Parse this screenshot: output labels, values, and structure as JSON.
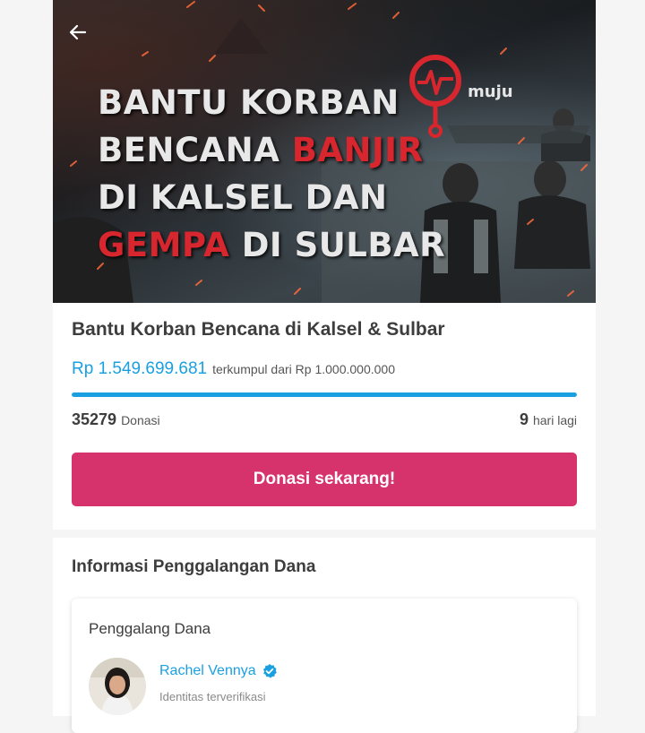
{
  "hero": {
    "title_lines": [
      {
        "parts": [
          "BANTU KORBAN",
          ""
        ],
        "highlight": ""
      },
      {
        "parts": [
          "BENCANA ",
          ""
        ],
        "highlight": "BANJIR"
      },
      {
        "parts": [
          "DI KALSEL DAN",
          ""
        ],
        "highlight": ""
      },
      {
        "parts": [
          "",
          " DI SULBAR"
        ],
        "highlight": "GEMPA"
      }
    ],
    "logo_text": "muju"
  },
  "campaign": {
    "title": "Bantu Korban Bencana di Kalsel & Sulbar",
    "raised_amount": "Rp 1.549.699.681",
    "raised_target_text": "terkumpul dari Rp 1.000.000.000",
    "progress_fraction": 1.0,
    "donations_count": "35279",
    "donations_label": "Donasi",
    "days_left": "9",
    "days_left_label": "hari lagi",
    "donate_button": "Donasi sekarang!"
  },
  "info": {
    "section_title": "Informasi Penggalangan Dana",
    "fundraiser_label": "Penggalang Dana",
    "fundraiser_name": "Rachel Vennya",
    "verified_text": "Identitas terverifikasi"
  },
  "colors": {
    "accent_blue": "#1aa0e0",
    "donate_pink": "#d6336c",
    "hero_red": "#d7262e"
  },
  "icons": {
    "back": "arrow-left-icon",
    "verified": "verified-check-icon",
    "logo": "location-pin-heartbeat-icon"
  }
}
